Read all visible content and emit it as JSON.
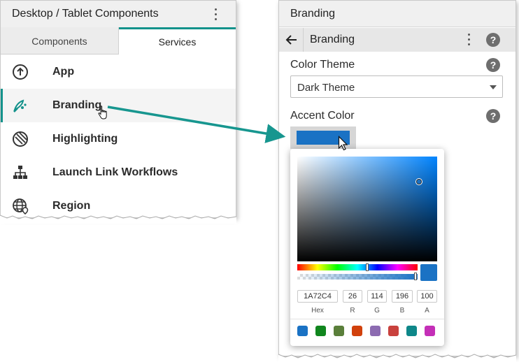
{
  "left_panel": {
    "title": "Desktop / Tablet Components",
    "tabs": [
      {
        "label": "Components",
        "active": false
      },
      {
        "label": "Services",
        "active": true
      }
    ],
    "items": [
      {
        "label": "App",
        "icon": "app-upload-icon"
      },
      {
        "label": "Branding",
        "icon": "palette-brush-icon",
        "selected": true
      },
      {
        "label": "Highlighting",
        "icon": "highlighting-icon"
      },
      {
        "label": "Launch Link Workflows",
        "icon": "hierarchy-icon"
      },
      {
        "label": "Region",
        "icon": "globe-location-icon"
      }
    ]
  },
  "right_panel": {
    "title": "Branding",
    "subheader": {
      "title": "Branding",
      "back_icon": "back-arrow-icon"
    },
    "color_theme": {
      "label": "Color Theme",
      "selected": "Dark Theme"
    },
    "accent_color": {
      "label": "Accent Color",
      "value": "#1A72C4"
    }
  },
  "color_picker": {
    "hex": "1A72C4",
    "r": "26",
    "g": "114",
    "b": "196",
    "a": "100",
    "labels": {
      "hex": "Hex",
      "r": "R",
      "g": "G",
      "b": "B",
      "a": "A"
    },
    "presets": [
      "#1a72c4",
      "#10861e",
      "#5a7f3a",
      "#d1410c",
      "#8c6bb1",
      "#c9413d",
      "#0e8789",
      "#c42fb7"
    ]
  },
  "colors": {
    "teal_accent": "#13928b",
    "arrow": "#17968f"
  }
}
